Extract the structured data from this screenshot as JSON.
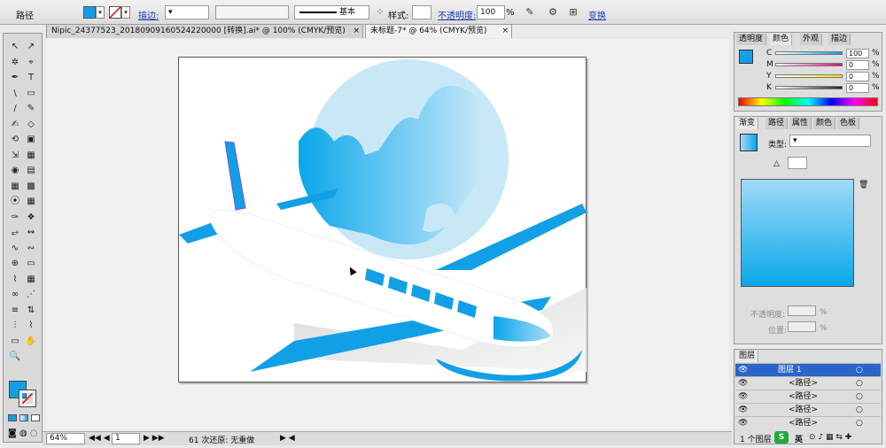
{
  "control_bar": {
    "object_type": "路径",
    "fill_color": "#11a0e6",
    "stroke_label": "描边:",
    "brush_label": "基本",
    "style_label": "样式:",
    "opacity_label": "不透明度:",
    "opacity_value": "100",
    "opacity_unit": "%",
    "transform_label": "变换"
  },
  "tabs": [
    {
      "label": "Nipic_24377523_20180909160524220000 [转换].ai* @ 100% (CMYK/预览)",
      "close": "×"
    },
    {
      "label": "未标题-7* @ 64% (CMYK/预览)",
      "close": "×"
    }
  ],
  "toolbox": {
    "tools": [
      "↖",
      "↗",
      "✲",
      "⌖",
      "✒",
      "T",
      "\\",
      "▭",
      "/",
      "✎",
      "✍",
      "◇",
      "⟲",
      "▣",
      "⇲",
      "▦",
      "◉",
      "▤",
      "▦",
      "▩",
      "⦿",
      "▦",
      "✑",
      "❖",
      "⥂",
      "↭",
      "∿",
      "∾",
      "⊕",
      "▭",
      "⌇",
      "▦",
      "∞",
      "⋰",
      "≡",
      "⇅",
      "⫶",
      "⌇",
      "▭",
      "✋",
      "🔍"
    ],
    "fill_color": "#11a0e6"
  },
  "status": {
    "zoom": "64%",
    "page": "1",
    "undo_text": "61 次还原: 无重做"
  },
  "color_panel": {
    "tabs": [
      "透明度",
      "颜色",
      "外观",
      "描边"
    ],
    "channels": [
      {
        "name": "C",
        "value": "100",
        "color": "#00a0e9"
      },
      {
        "name": "M",
        "value": "0",
        "color": "#e4007f"
      },
      {
        "name": "Y",
        "value": "0",
        "color": "#f5e600"
      },
      {
        "name": "K",
        "value": "0",
        "color": "#222222"
      }
    ],
    "unit": "%"
  },
  "gradient_panel": {
    "tabs": [
      "渐变",
      "路径",
      "属性",
      "颜色",
      "色板"
    ],
    "type_label": "类型:",
    "opacity_label": "不透明度:",
    "location_label": "位置:",
    "unit": "%",
    "start_color": "#9fdaf7",
    "end_color": "#0aa7ea"
  },
  "layers_panel": {
    "title": "图层",
    "rows": [
      {
        "name": "图层 1",
        "selected": true
      },
      {
        "name": "<路径>",
        "selected": false
      },
      {
        "name": "<路径>",
        "selected": false
      },
      {
        "name": "<路径>",
        "selected": false
      },
      {
        "name": "<路径>",
        "selected": false
      }
    ],
    "footer": "1 个图层"
  },
  "ime": {
    "label": "英",
    "logo": "S"
  },
  "colors": {
    "brand_blue": "#11a0e6",
    "globe_light": "#c8e8f8",
    "plane_white": "#ffffff"
  }
}
